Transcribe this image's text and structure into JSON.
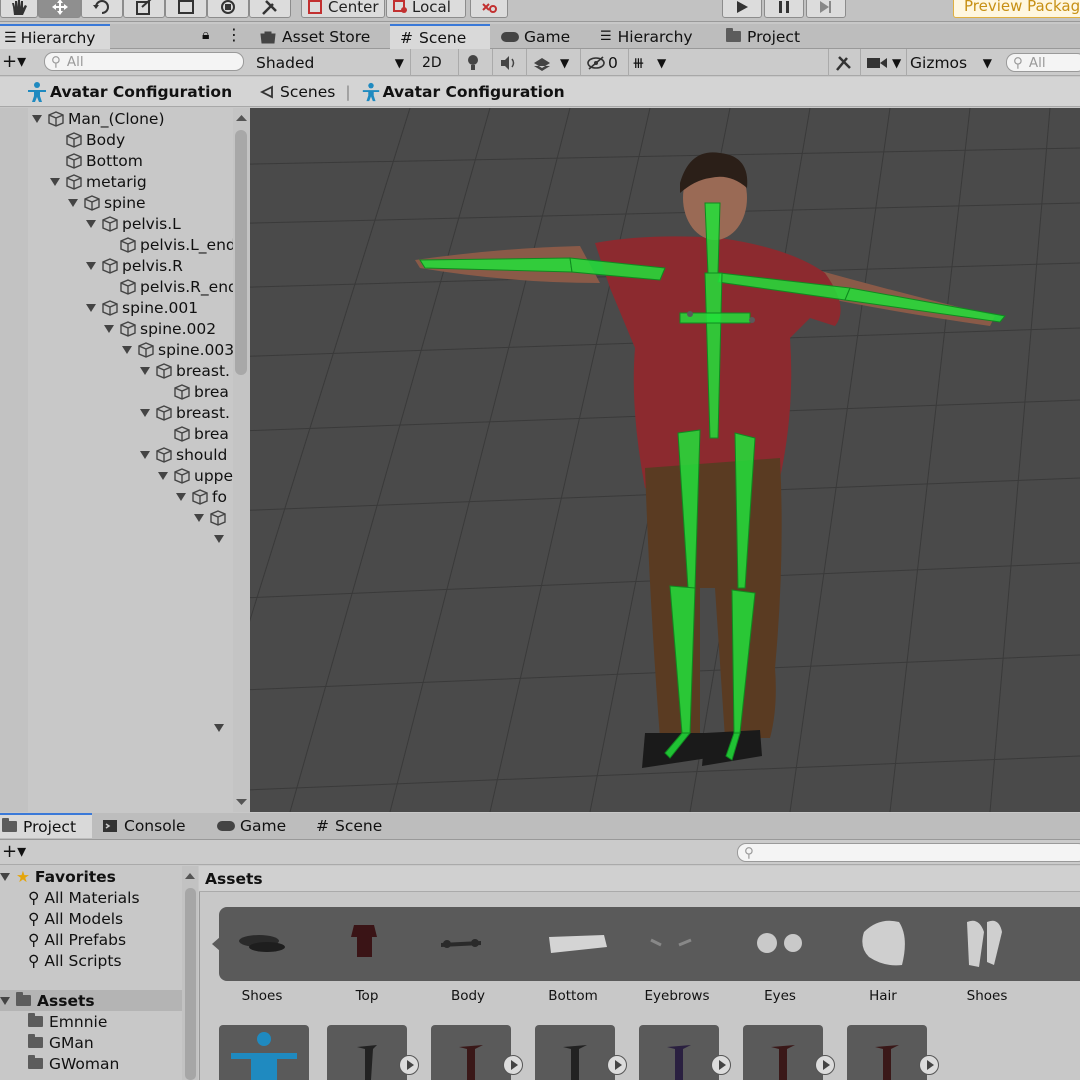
{
  "toolbar": {
    "pivot_label": "Center",
    "space_label": "Local",
    "preview_label": "Preview Packag"
  },
  "hierarchy": {
    "tab_label": "Hierarchy",
    "search_placeholder": "All",
    "header": "Avatar Configuration",
    "nodes": [
      {
        "label": "Man_(Clone)"
      },
      {
        "label": "Body"
      },
      {
        "label": "Bottom"
      },
      {
        "label": "metarig"
      },
      {
        "label": "spine"
      },
      {
        "label": "pelvis.L"
      },
      {
        "label": "pelvis.L_end"
      },
      {
        "label": "pelvis.R"
      },
      {
        "label": "pelvis.R_end"
      },
      {
        "label": "spine.001"
      },
      {
        "label": "spine.002"
      },
      {
        "label": "spine.003"
      },
      {
        "label": "breast."
      },
      {
        "label": "brea"
      },
      {
        "label": "breast."
      },
      {
        "label": "brea"
      },
      {
        "label": "should"
      },
      {
        "label": "uppe"
      },
      {
        "label": "fo"
      },
      {
        "label": ""
      },
      {
        "label": ""
      }
    ]
  },
  "scene": {
    "tabs": [
      {
        "label": "Asset Store"
      },
      {
        "label": "Scene"
      },
      {
        "label": "Game"
      },
      {
        "label": "Hierarchy"
      },
      {
        "label": "Project"
      }
    ],
    "shading_mode": "Shaded",
    "mode_2d": "2D",
    "hidden_count": "0",
    "gizmos_label": "Gizmos",
    "search_placeholder": "All",
    "breadcrumb_root": "Scenes",
    "breadcrumb_current": "Avatar Configuration"
  },
  "project": {
    "tabs": [
      {
        "label": "Project"
      },
      {
        "label": "Console"
      },
      {
        "label": "Game"
      },
      {
        "label": "Scene"
      }
    ],
    "favorites_label": "Favorites",
    "favorites": [
      {
        "label": "All Materials"
      },
      {
        "label": "All Models"
      },
      {
        "label": "All Prefabs"
      },
      {
        "label": "All Scripts"
      }
    ],
    "assets_label": "Assets",
    "folders": [
      {
        "label": "Emnnie"
      },
      {
        "label": "GMan"
      },
      {
        "label": "GWoman"
      }
    ],
    "breadcrumb": "Assets",
    "asset_items": [
      {
        "label": "Shoes"
      },
      {
        "label": "Top"
      },
      {
        "label": "Body"
      },
      {
        "label": "Bottom"
      },
      {
        "label": "Eyebrows"
      },
      {
        "label": "Eyes"
      },
      {
        "label": "Hair"
      },
      {
        "label": "Shoes"
      }
    ]
  },
  "colors": {
    "skeleton_green": "#22e03a",
    "selected_tab_accent": "#3a79d8",
    "viewport_bg": "#4a4a4a"
  }
}
